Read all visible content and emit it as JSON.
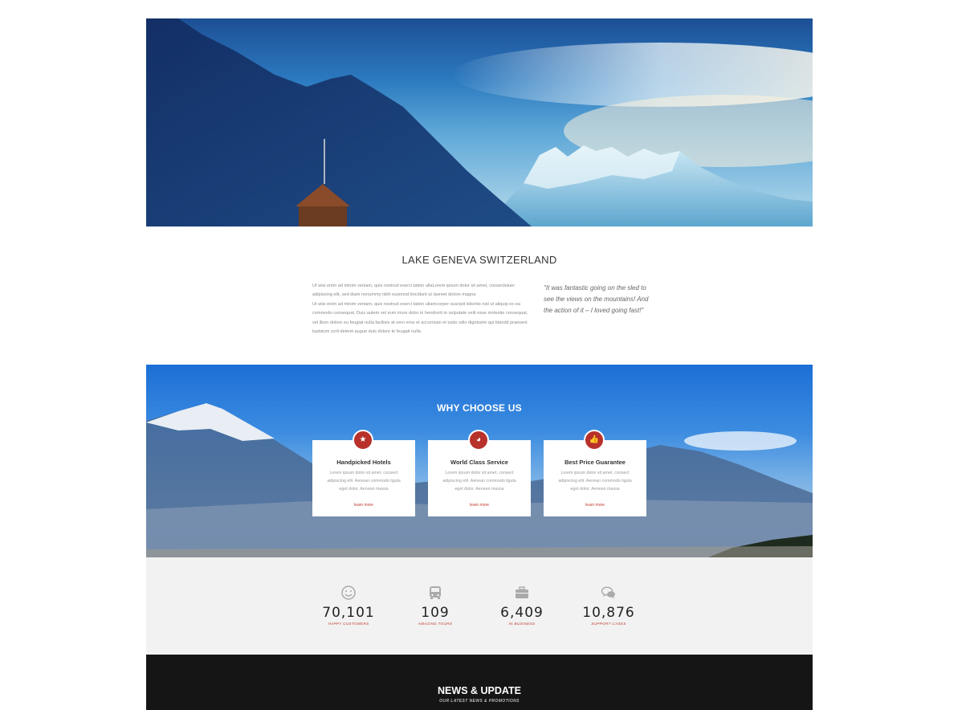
{
  "intro": {
    "title": "LAKE GENEVA SWITZERLAND",
    "paragraph_1": "Ut wisi enim ad minim veniam, quis nostrud exerci tation ullaLorem ipsum dolor sit amet, consectetuer adipiscing elit, sed diam nonummy nibh euismod tincidunt ut laoreet dolore magna",
    "paragraph_2": "Ut wisi enim ad minim veniam, quis nostrud exerci tation ullamcorper suscipit lobortis nisl ut aliquip ex ea commodo consequat. Duis autem vel eum iriure dolor in hendrerit in vulputate velit esse molestie consequat, vel illum dolore eu feugiat nulla facilisis at vero eros et accumsan et iusto odio dignissim qui blandit praesent luptatum zzril delenit augue duis dolore te feugait nulla",
    "quote": "\"It was fantastic going on the sled to see the views on the mountains! And the action of it – I loved going fast!\""
  },
  "why": {
    "title": "WHY CHOOSE US",
    "cards": [
      {
        "icon": "star-icon",
        "glyph": "★",
        "title": "Handpicked Hotels",
        "text": "Lorem ipsum dolor sit amet, consect adipiscing elit. Aenean commodo ligula eget dolor. Aenean massa",
        "link": "learn more"
      },
      {
        "icon": "globe-icon",
        "glyph": "◕",
        "title": "World Class Service",
        "text": "Lorem ipsum dolor sit amet, consect adipiscing elit. Aenean commodo ligula eget dolor. Aenean massa",
        "link": "learn more"
      },
      {
        "icon": "thumbs-up-icon",
        "glyph": "👍",
        "title": "Best Price Guarantee",
        "text": "Lorem ipsum dolor sit amet, consect adipiscing elit. Aenean commodo ligula eget dolor. Aenean massa",
        "link": "learn more"
      }
    ]
  },
  "stats": [
    {
      "icon": "smiley-icon",
      "number": "70,101",
      "label": "HAPPY CUSTOMERS"
    },
    {
      "icon": "bus-icon",
      "number": "109",
      "label": "AMAZING TOURS"
    },
    {
      "icon": "briefcase-icon",
      "number": "6,409",
      "label": "IN BUSINESS"
    },
    {
      "icon": "chat-bubbles-icon",
      "number": "10,876",
      "label": "SUPPORT CASES"
    }
  ],
  "news": {
    "title": "NEWS & UPDATE",
    "subtitle": "OUR LATEST NEWS & PROMOTIONS"
  },
  "colors": {
    "accent": "#b8312b",
    "dark_section": "#151515",
    "stats_background": "#f2f2f2"
  }
}
